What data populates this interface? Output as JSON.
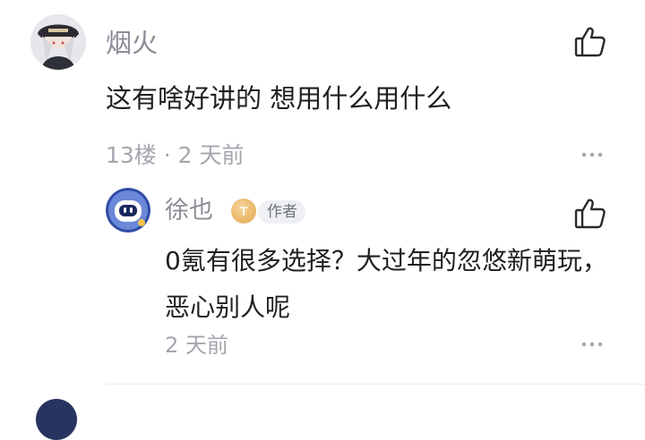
{
  "comment": {
    "author": "烟火",
    "text": "这有啥好讲的 想用什么用什么",
    "meta": "13楼 · 2 天前",
    "like_icon": "thumbs-up-icon",
    "more_icon": "more-dots-icon"
  },
  "reply": {
    "author": "徐也",
    "level_badge": "T",
    "author_badge": "作者",
    "text": "0氪有很多选择？大过年的忽悠新萌玩，恶心别人呢",
    "meta": "2 天前",
    "like_icon": "thumbs-up-icon",
    "more_icon": "more-dots-icon"
  }
}
